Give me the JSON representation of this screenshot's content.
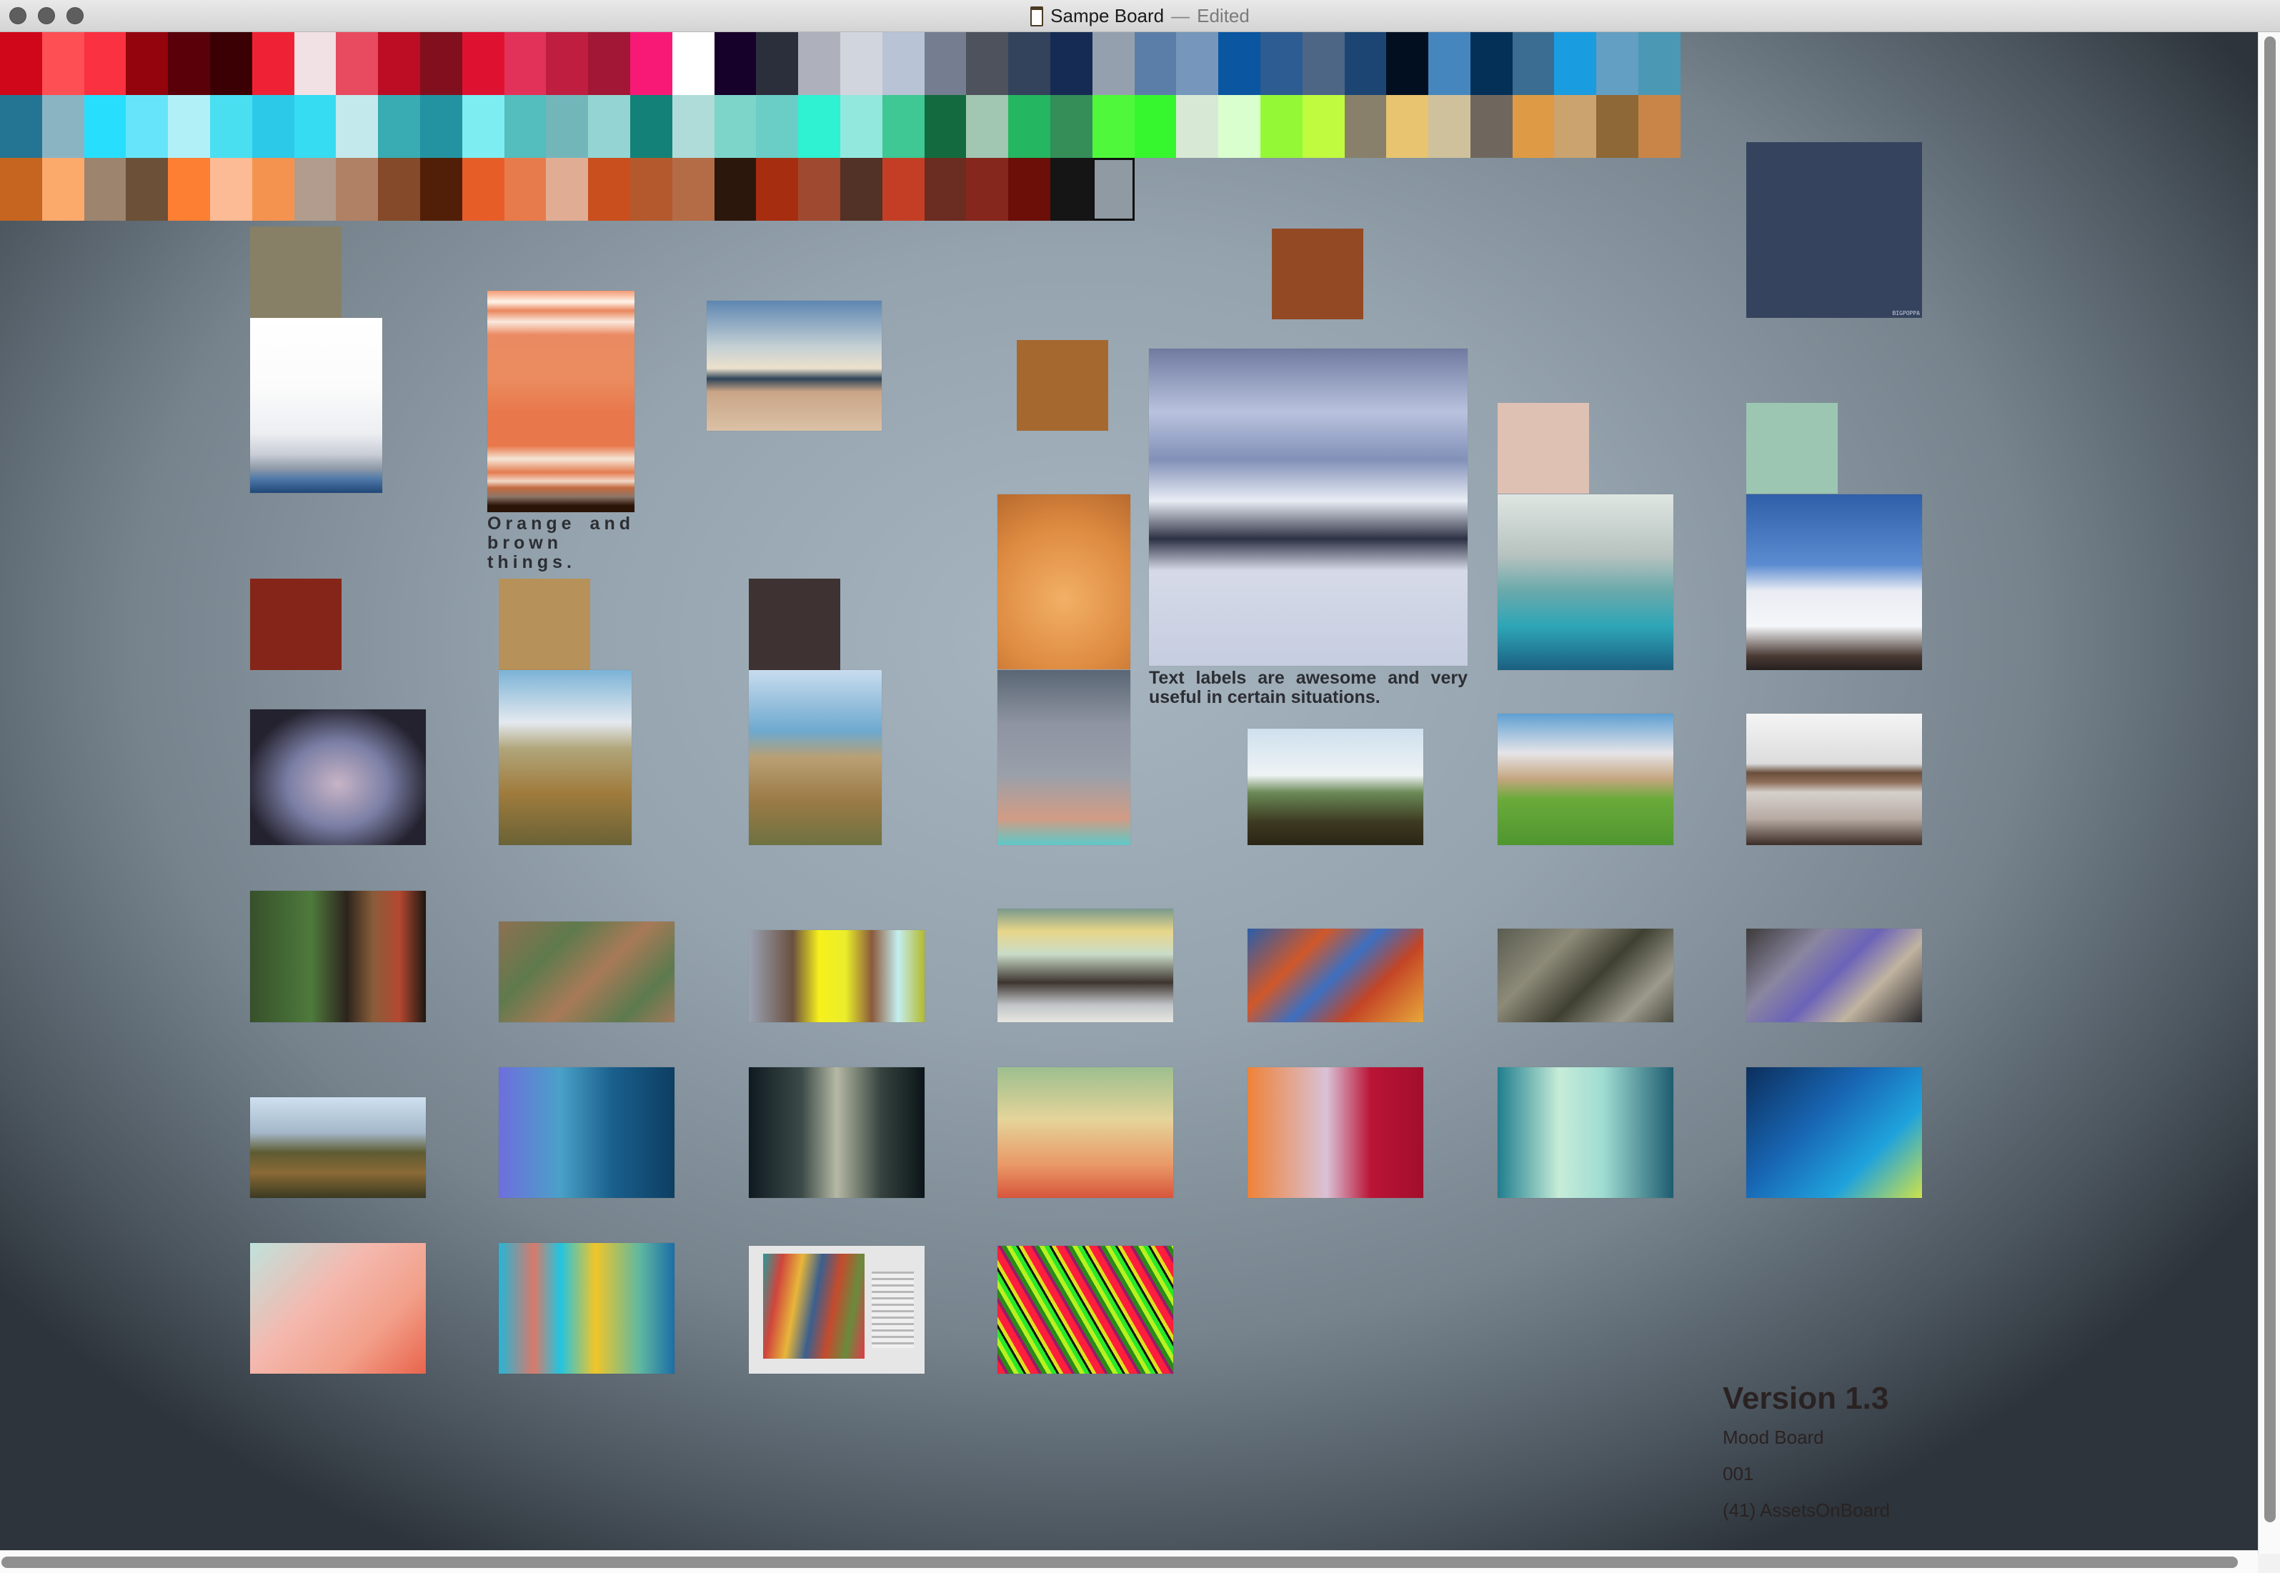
{
  "window": {
    "title": "Sampe Board",
    "separator": "—",
    "status": "Edited",
    "controls": [
      "close",
      "minimize",
      "zoom"
    ]
  },
  "palette": {
    "rows": [
      [
        "#D0071A",
        "#FE4F54",
        "#FA3140",
        "#94040D",
        "#590009",
        "#3A0004",
        "#EF2235",
        "#F1E1E4",
        "#E84A5F",
        "#BC0D24",
        "#820F1E",
        "#DF1131",
        "#E2325A",
        "#BF1E40",
        "#A21736",
        "#F81977",
        "#FFFFFF",
        "#16012A",
        "#2B2F3C",
        "#AEB1BC",
        "#D1D5DE",
        "#B9C3D6",
        "#747E90",
        "#4E525C",
        "#34435C",
        "#162B53",
        "#95A0AE",
        "#5B7EA8",
        "#7697BB",
        "#0A56A0",
        "#2C5C92",
        "#4D6686",
        "#1C4574",
        "#010F20",
        "#4686BE",
        "#043058",
        "#3A6D91",
        "#1A9CE1",
        "#639FC2",
        "#4B98B5"
      ],
      [
        "#247493",
        "#8BB4C3",
        "#27DFFD",
        "#66E5FA",
        "#B2F0F8",
        "#4ADEF1",
        "#2CC9E8",
        "#36DCF1",
        "#C3E9EC",
        "#38ABB3",
        "#2393A1",
        "#7DEDF1",
        "#54BDBD",
        "#73B6BA",
        "#94D5D3",
        "#138177",
        "#AFDCD9",
        "#7DD5CA",
        "#6BCEC6",
        "#2EF2D1",
        "#93E8DD",
        "#3FC794",
        "#136A3F",
        "#A1C7B3",
        "#24B660",
        "#358E58",
        "#4FF83A",
        "#36F72E",
        "#D7E9D4",
        "#D9FFCE",
        "#95F836",
        "#C0FB3F",
        "#88806A",
        "#E8C470",
        "#CFC19B",
        "#6F675E",
        "#DE9A44",
        "#CBA36F",
        "#8E6837",
        "#C98548"
      ],
      [
        "#C5651F",
        "#FCA96C",
        "#9C846E",
        "#6C5038",
        "#FC7F33",
        "#FCBB95",
        "#F49350",
        "#B19C8D",
        "#B08164",
        "#844A29",
        "#511F07",
        "#E75D28",
        "#E77B4C",
        "#E0AD94",
        "#C94F1E",
        "#B4592D",
        "#B46C46",
        "#2C170D",
        "#A62D10",
        "#9F4930",
        "#523126",
        "#C43E26",
        "#6B2C21",
        "#85271C",
        "#6B0F08",
        "#151515",
        "#8F9AA3"
      ]
    ],
    "selected_index": [
      2,
      26
    ]
  },
  "board": {
    "color_swatches": [
      {
        "name": "olive",
        "color": "#878066"
      },
      {
        "name": "brown",
        "color": "#A5692F"
      },
      {
        "name": "rust",
        "color": "#934A24"
      },
      {
        "name": "navy",
        "color": "#35435E",
        "tag": "BIGPOPPA"
      },
      {
        "name": "blush",
        "color": "#DFC1B4"
      },
      {
        "name": "mint",
        "color": "#9CC6B2"
      },
      {
        "name": "brick-red",
        "color": "#852519"
      },
      {
        "name": "tan",
        "color": "#B7915A"
      },
      {
        "name": "dark-brown",
        "color": "#3E3332"
      }
    ],
    "images": [
      "white-blue-landscape",
      "orange-stripes-abstract",
      "watercolor-painting",
      "hockey-player-mountains",
      "ramen-noodles",
      "hot-spring-snow",
      "sled-dogs-snow",
      "painted-hands",
      "yellow-corn-field",
      "dark-corn-field",
      "gray-kitten",
      "green-valley",
      "green-meadow",
      "lake-reflection",
      "window-food-table",
      "aerial-terrain",
      "yellow-glitch",
      "anime-glitch",
      "colorful-glitch",
      "gray-glitch",
      "purple-glitch",
      "windswept-tree",
      "blue-abstract",
      "dark-smoke-abstract",
      "warm-abstract",
      "orange-red-abstract",
      "teal-abstract",
      "blue-green-abstract",
      "peach-abstract",
      "cyan-yellow-abstract",
      "app-screenshot",
      "diagonal-color-stripes"
    ],
    "captions": {
      "orange": "Orange and brown things.",
      "hockey": "Text labels are awesome and very useful in certain situations."
    }
  },
  "info": {
    "title": "Version 1.3",
    "line1": "Mood Board",
    "line2": "001",
    "line3": "(41) AssetsOnBoard"
  }
}
